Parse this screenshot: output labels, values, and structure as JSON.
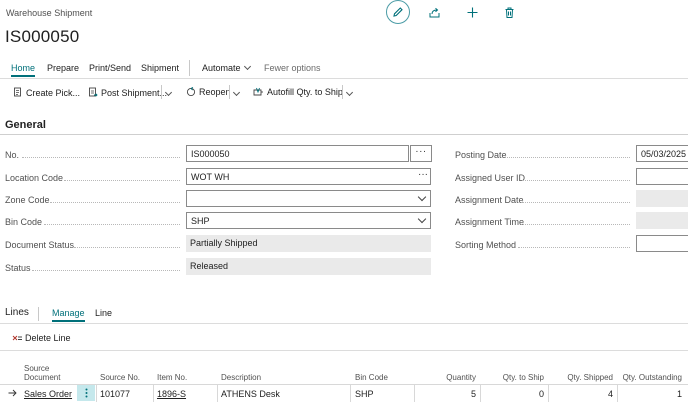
{
  "header": {
    "page_type": "Warehouse Shipment",
    "record_no": "IS000050",
    "top_icons": [
      "edit-pencil-icon",
      "share-icon",
      "add-icon",
      "delete-icon"
    ]
  },
  "action_tabs": [
    "Home",
    "Prepare",
    "Print/Send",
    "Shipment",
    "Automate",
    "Fewer options"
  ],
  "commands": {
    "create_pick": "Create Pick...",
    "post_shipment": "Post Shipment...",
    "reopen": "Reopen",
    "autofill": "Autofill Qty. to Ship"
  },
  "general": {
    "title": "General",
    "no_label": "No.",
    "no_value": "IS000050",
    "location_label": "Location Code",
    "location_value": "WOT WH",
    "zone_label": "Zone Code",
    "zone_value": "",
    "bin_label": "Bin Code",
    "bin_value": "SHP",
    "doc_status_label": "Document Status",
    "doc_status_value": "Partially Shipped",
    "status_label": "Status",
    "status_value": "Released",
    "posting_date_label": "Posting Date",
    "posting_date_value": "05/03/2025",
    "assigned_user_label": "Assigned User ID",
    "assigned_user_value": "",
    "assignment_date_label": "Assignment Date",
    "assignment_time_label": "Assignment Time",
    "sorting_method_label": "Sorting Method",
    "sorting_method_value": ""
  },
  "lines": {
    "title": "Lines",
    "tabs": [
      "Manage",
      "Line"
    ],
    "delete_line": "Delete Line",
    "columns": {
      "source_doc_1": "Source",
      "source_doc_2": "Document",
      "source_no": "Source No.",
      "item_no": "Item No.",
      "description": "Description",
      "bin_code": "Bin Code",
      "quantity": "Quantity",
      "qty_to_ship": "Qty. to Ship",
      "qty_shipped": "Qty. Shipped",
      "qty_outstanding": "Qty. Outstanding"
    },
    "rows": [
      {
        "source_document": "Sales Order",
        "source_no": "101077",
        "item_no": "1896-S",
        "description": "ATHENS Desk",
        "bin_code": "SHP",
        "quantity": "5",
        "qty_to_ship": "0",
        "qty_shipped": "4",
        "qty_outstanding": "1"
      }
    ]
  },
  "colors": {
    "accent": "#00707a",
    "selection": "#c5e8ec"
  }
}
